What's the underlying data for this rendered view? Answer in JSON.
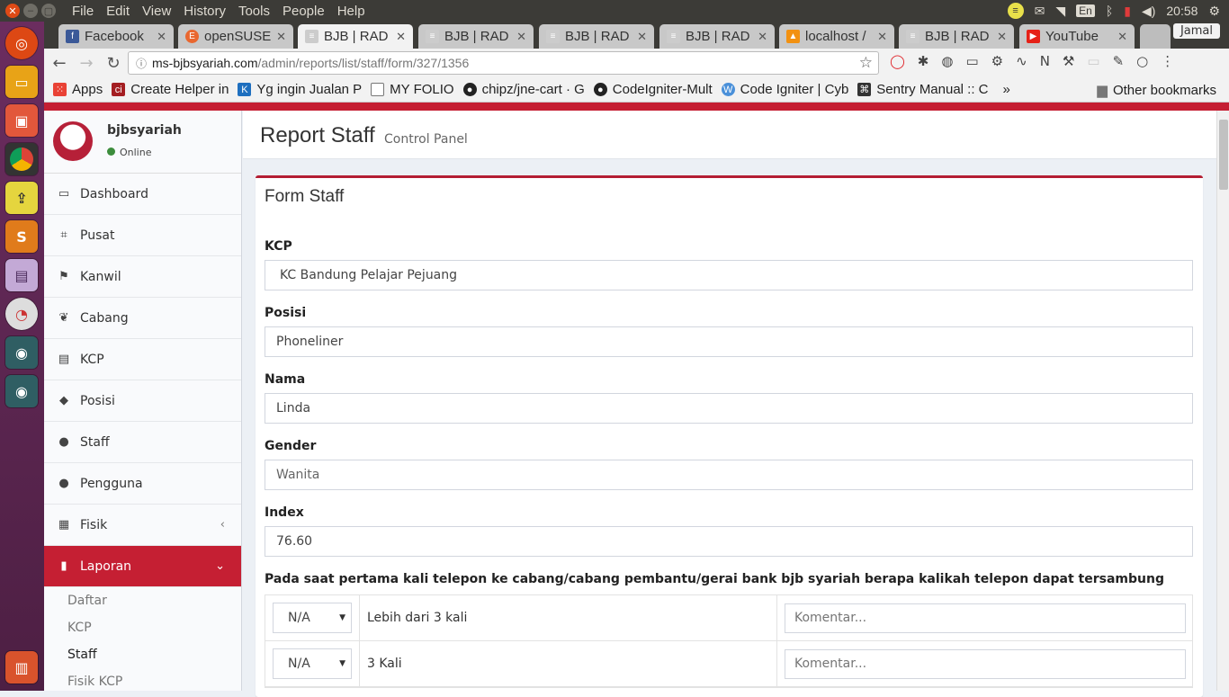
{
  "os": {
    "menus": [
      "File",
      "Edit",
      "View",
      "History",
      "Tools",
      "People",
      "Help"
    ],
    "tray": {
      "lang": "En",
      "time": "20:58"
    },
    "user": "Jamal"
  },
  "browser": {
    "tabs": [
      {
        "title": "Facebook",
        "favicon_color": "#3b5998",
        "favicon": "f",
        "active": false
      },
      {
        "title": "openSUSE",
        "favicon_color": "#e9672f",
        "favicon": "E",
        "active": false
      },
      {
        "title": "BJB | RAD",
        "favicon_color": "#bbbbbb",
        "favicon": "≡",
        "active": true
      },
      {
        "title": "BJB | RAD",
        "favicon_color": "#bbbbbb",
        "favicon": "≡",
        "active": false
      },
      {
        "title": "BJB | RAD",
        "favicon_color": "#bbbbbb",
        "favicon": "≡",
        "active": false
      },
      {
        "title": "BJB | RAD",
        "favicon_color": "#bbbbbb",
        "favicon": "≡",
        "active": false
      },
      {
        "title": "localhost /",
        "favicon_color": "#f29111",
        "favicon": "▲",
        "active": false
      },
      {
        "title": "BJB | RAD",
        "favicon_color": "#bbbbbb",
        "favicon": "≡",
        "active": false
      },
      {
        "title": "YouTube",
        "favicon_color": "#e62117",
        "favicon": "▶",
        "active": false
      }
    ],
    "url_host": "ms-bjbsyariah.com",
    "url_path": "/admin/reports/list/staff/form/327/1356",
    "bookmarks": [
      {
        "label": "Apps",
        "icon_color": "#e94235"
      },
      {
        "label": "Create Helper in",
        "icon_color": "#a41e22"
      },
      {
        "label": "Yg ingin Jualan P",
        "icon_color": "#1e6fbf"
      },
      {
        "label": "MY FOLIO",
        "icon_color": "#777777"
      },
      {
        "label": "chipz/jne-cart · G",
        "icon_color": "#222222"
      },
      {
        "label": "CodeIgniter-Mult",
        "icon_color": "#222222"
      },
      {
        "label": "Code Igniter | Cyb",
        "icon_color": "#4a90d9"
      },
      {
        "label": "Sentry Manual :: C",
        "icon_color": "#333333"
      }
    ],
    "other_bookmarks": "Other bookmarks"
  },
  "sidebar": {
    "user_name": "bjbsyariah",
    "status": "Online",
    "items": [
      {
        "label": "Dashboard",
        "icon": "desktop-icon",
        "glyph": "▭"
      },
      {
        "label": "Pusat",
        "icon": "sitemap-icon",
        "glyph": "⌗"
      },
      {
        "label": "Kanwil",
        "icon": "flag-icon",
        "glyph": "⚑"
      },
      {
        "label": "Cabang",
        "icon": "leaf-icon",
        "glyph": "❦"
      },
      {
        "label": "KCP",
        "icon": "building-icon",
        "glyph": "▤"
      },
      {
        "label": "Posisi",
        "icon": "tag-icon",
        "glyph": "◆"
      },
      {
        "label": "Staff",
        "icon": "users-icon",
        "glyph": "●"
      },
      {
        "label": "Pengguna",
        "icon": "user-icon",
        "glyph": "●"
      },
      {
        "label": "Fisik",
        "icon": "building-icon",
        "glyph": "▦"
      }
    ],
    "laporan": {
      "label": "Laporan",
      "icon": "file-icon",
      "glyph": "▮"
    },
    "subitems": [
      "Daftar",
      "KCP",
      "Staff",
      "Fisik KCP"
    ]
  },
  "page": {
    "title": "Report Staff",
    "subtitle": "Control Panel",
    "form_title": "Form Staff",
    "fields": [
      {
        "label": "KCP",
        "value": "KC Bandung Pelajar Pejuang"
      },
      {
        "label": "Posisi",
        "value": "Phoneliner"
      },
      {
        "label": "Nama",
        "value": "Linda"
      },
      {
        "label": "Gender",
        "value": "Wanita"
      },
      {
        "label": "Index",
        "value": "76.60"
      }
    ],
    "question": "Pada saat pertama kali telepon ke cabang/cabang pembantu/gerai bank bjb syariah berapa kalikah telepon dapat tersambung",
    "rows": [
      {
        "select": "N/A",
        "option": "Lebih dari 3 kali",
        "comment_placeholder": "Komentar..."
      },
      {
        "select": "N/A",
        "option": "3 Kali",
        "comment_placeholder": "Komentar..."
      }
    ]
  }
}
